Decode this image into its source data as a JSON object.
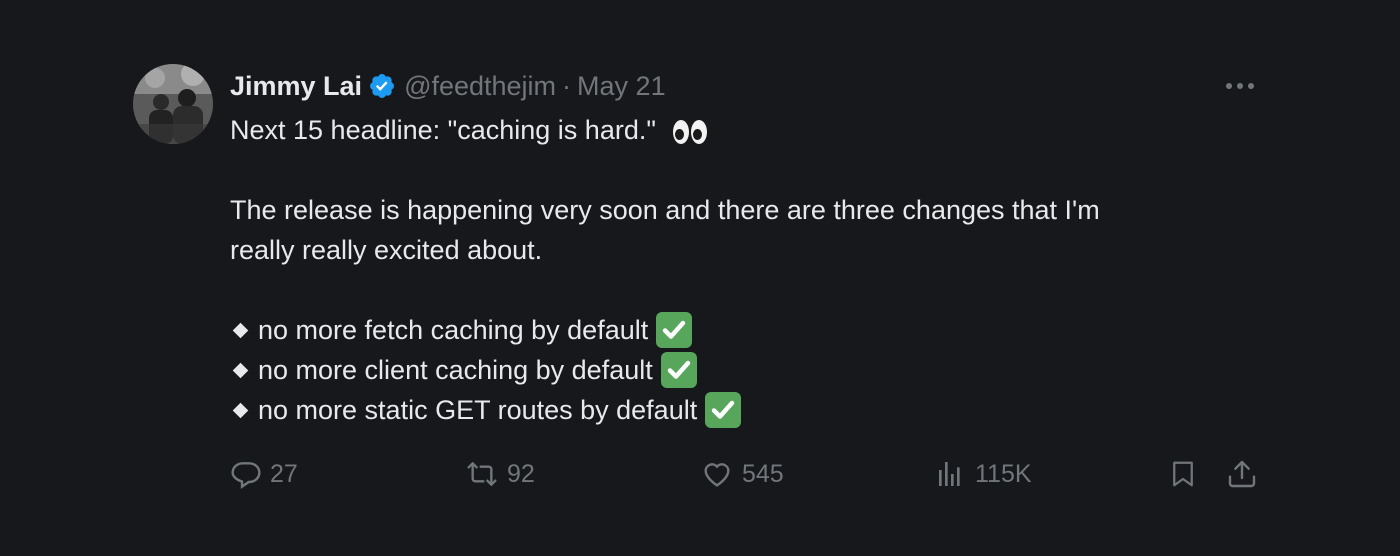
{
  "author": {
    "name": "Jimmy Lai",
    "handle": "@feedthejim",
    "separator": "·",
    "date": "May 21",
    "verified": true
  },
  "tweet": {
    "line1": "Next 15 headline: \"caching is hard.\"",
    "line1_emoji": "eyes",
    "para2_line1": "The release is happening very soon and there are three changes that I'm",
    "para2_line2": "really really excited about.",
    "bullets": [
      "no more fetch caching by default",
      "no more client caching by default",
      "no more static GET routes by default"
    ],
    "bullet_emoji": "check-mark-button"
  },
  "actions": {
    "replies": "27",
    "reposts": "92",
    "likes": "545",
    "views": "115K"
  },
  "colors": {
    "background": "#17181c",
    "text": "#e7e9ea",
    "muted": "#71767b",
    "verified": "#1d9bf0",
    "check": "#58a55c"
  }
}
